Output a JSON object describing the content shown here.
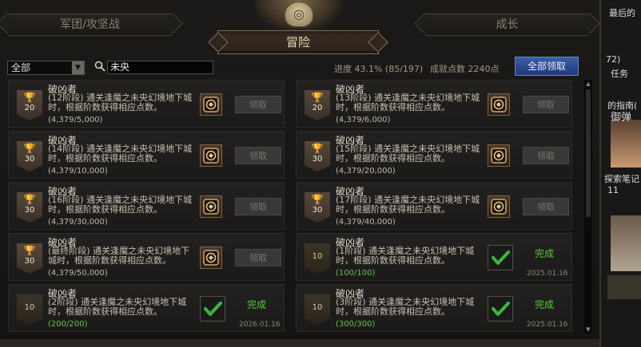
{
  "header": {
    "tab_left": "军团/攻坚战",
    "tab_right": "成长",
    "tab_active": "冒险"
  },
  "filter": {
    "selected": "全部",
    "search_value": "未央"
  },
  "stats": {
    "progress": "进度  43.1% (85/197)",
    "points": "成就点数 2240点",
    "claim_all": "全部领取"
  },
  "left_column": [
    {
      "title": "破凶者",
      "desc": "(12阶段) 通关逢魔之未央幻境地下城时，根据阶数获得相应点数。",
      "progress": "(4,379/5,000)",
      "points": "20",
      "state": "claim",
      "button": "领取"
    },
    {
      "title": "破凶者",
      "desc": "(14阶段) 通关逢魔之未央幻境地下城时，根据阶数获得相应点数。",
      "progress": "(4,379/10,000)",
      "points": "30",
      "state": "claim",
      "button": "领取"
    },
    {
      "title": "破凶者",
      "desc": "(16阶段) 通关逢魔之未央幻境地下城时，根据阶数获得相应点数。",
      "progress": "(4,379/30,000)",
      "points": "30",
      "state": "claim",
      "button": "领取"
    },
    {
      "title": "破凶者",
      "desc": "(最终阶段) 通关逢魔之未央幻境地下城时，根据阶数获得相应点数。",
      "progress": "(4,379/50,000)",
      "points": "30",
      "state": "claim",
      "button": "领取"
    },
    {
      "title": "破凶者",
      "desc": "(2阶段) 通关逢魔之未央幻境地下城时，根据阶数获得相应点数。",
      "progress": "(200/200)",
      "points": "10",
      "state": "done",
      "done": "完成",
      "date": "2026.01.16"
    }
  ],
  "right_column": [
    {
      "title": "破凶者",
      "desc": "(13阶段) 通关逢魔之未央幻境地下城时，根据阶数获得相应点数。",
      "progress": "(4,379/6,000)",
      "points": "20",
      "state": "claim",
      "button": "领取"
    },
    {
      "title": "破凶者",
      "desc": "(15阶段) 通关逢魔之未央幻境地下城时，根据阶数获得相应点数。",
      "progress": "(4,379/20,000)",
      "points": "30",
      "state": "claim",
      "button": "领取"
    },
    {
      "title": "破凶者",
      "desc": "(17阶段) 通关逢魔之未央幻境地下城时，根据阶数获得相应点数。",
      "progress": "(4,379/40,000)",
      "points": "30",
      "state": "claim",
      "button": "领取"
    },
    {
      "title": "破凶者",
      "desc": "(1阶段) 通关逢魔之未央幻境地下城时，根据阶数获得相应点数。",
      "progress": "(100/100)",
      "points": "10",
      "state": "done",
      "done": "完成",
      "date": "2025.01.16"
    },
    {
      "title": "破凶者",
      "desc": "(3阶段) 通关逢魔之未央幻境地下城时，根据阶数获得相应点数。",
      "progress": "(300/300)",
      "points": "10",
      "state": "done",
      "done": "完成",
      "date": "2025.01.16"
    }
  ],
  "side": {
    "line1": "最后的",
    "line2": "72)",
    "line3": "任务",
    "line4": "的指南(",
    "line5": "御弹",
    "line6": "探索笔记",
    "line7": "11"
  },
  "colors": {
    "accent_blue": "#2f4f98",
    "complete_green": "#5ac840",
    "panel_bg": "#1c1a18"
  }
}
